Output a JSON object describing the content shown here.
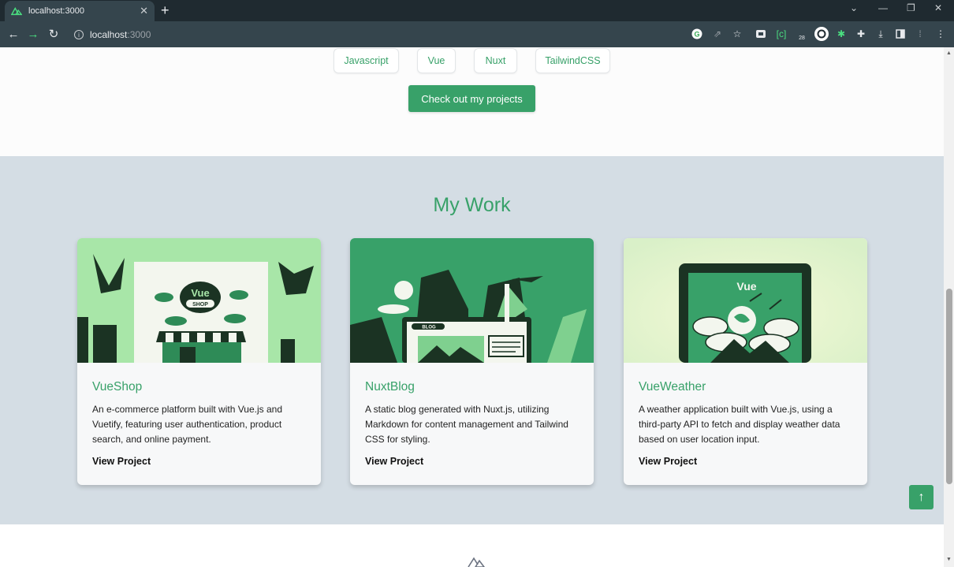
{
  "browser": {
    "tab_title": "localhost:3000",
    "url_host": "localhost",
    "url_port": ":3000",
    "window_controls": [
      "minimize",
      "restore",
      "close"
    ],
    "extension_badge": "28"
  },
  "hero": {
    "skills": [
      "Javascript",
      "Vue",
      "Nuxt",
      "TailwindCSS"
    ],
    "cta_label": "Check out my projects"
  },
  "work": {
    "title": "My Work",
    "projects": [
      {
        "title": "VueShop",
        "description": "An e-commerce platform built with Vue.js and Vuetify, featuring user authentication, product search, and online payment.",
        "link_label": "View Project",
        "image_sign_top": "Vue",
        "image_sign_bottom": "SHOP"
      },
      {
        "title": "NuxtBlog",
        "description": "A static blog generated with Nuxt.js, utilizing Markdown for content management and Tailwind CSS for styling.",
        "link_label": "View Project",
        "image_sign": "BLOG"
      },
      {
        "title": "VueWeather",
        "description": "A weather application built with Vue.js, using a third-party API to fetch and display weather data based on user location input.",
        "link_label": "View Project",
        "image_sign": "Vue"
      }
    ]
  },
  "colors": {
    "accent": "#38a169",
    "section_bg": "#d4dde4",
    "card_bg": "#f7f8f9"
  }
}
